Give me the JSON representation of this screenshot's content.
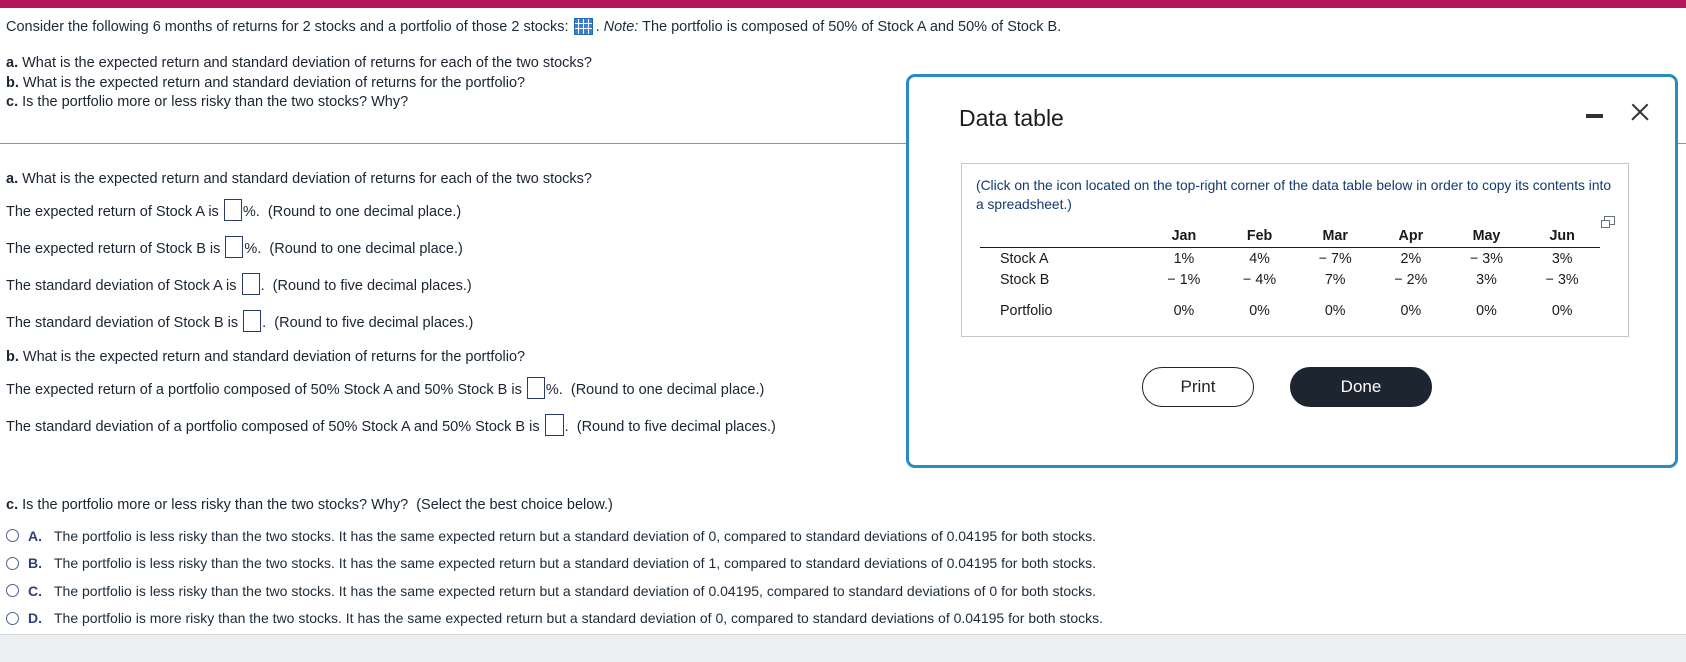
{
  "theme": {
    "accent_bar_color": "#b4175c",
    "dialog_border_color": "#2b8cbe",
    "link_text_color": "#123a6e",
    "done_button_color": "#1d2530"
  },
  "worksheet": {
    "intro_prefix": "Consider the following 6 months of returns for 2 stocks and a portfolio of those 2 stocks:",
    "intro_icon": "spreadsheet-grid-icon",
    "intro_separator": ".",
    "note_label": "Note:",
    "intro_suffix": "The portfolio is composed of 50% of Stock A and 50% of Stock B.",
    "questions": [
      {
        "letter": "a.",
        "text": "What is the expected return and standard deviation of returns for each of the two stocks?"
      },
      {
        "letter": "b.",
        "text": "What is the expected return and standard deviation of returns for the portfolio?"
      },
      {
        "letter": "c.",
        "text": "Is the portfolio more or less risky than the two stocks? Why?"
      }
    ]
  },
  "answers": {
    "part_a_heading_letter": "a.",
    "part_a_heading": "What is the expected return and standard deviation of returns for each of the two stocks?",
    "rows_a": [
      {
        "pre": "The expected return of Stock A is",
        "blank_value": "",
        "post_unit": "%.",
        "hint": "(Round to one decimal place.)"
      },
      {
        "pre": "The expected return of Stock B is",
        "blank_value": "",
        "post_unit": "%.",
        "hint": "(Round to one decimal place.)"
      },
      {
        "pre": "The standard deviation of Stock A is",
        "blank_value": "",
        "post_unit": ".",
        "hint": "(Round to five decimal places.)"
      },
      {
        "pre": "The standard deviation of Stock B is",
        "blank_value": "",
        "post_unit": ".",
        "hint": "(Round to five decimal places.)"
      }
    ],
    "part_b_heading_letter": "b.",
    "part_b_heading": "What is the expected return and standard deviation of returns for the portfolio?",
    "rows_b": [
      {
        "pre": "The expected return of a portfolio composed of 50% Stock A and 50% Stock B is",
        "blank_value": "",
        "post_unit": "%.",
        "hint": "(Round to one decimal place.)"
      },
      {
        "pre": "The standard deviation of a portfolio composed of 50% Stock A and 50% Stock B is",
        "blank_value": "",
        "post_unit": ".",
        "hint": "(Round to five decimal places.)"
      }
    ]
  },
  "choices": {
    "prompt_letter": "c.",
    "prompt": "Is the portfolio more or less risky than the two stocks? Why?",
    "prompt_hint": "(Select the best choice below.)",
    "selected": null,
    "options": [
      {
        "letter": "A.",
        "text": "The portfolio is less risky than the two stocks. It has the same expected return but a standard deviation of 0, compared to standard deviations of 0.04195 for both stocks."
      },
      {
        "letter": "B.",
        "text": "The portfolio is less risky than the two stocks. It has the same expected return but a standard deviation of 1, compared to standard deviations of 0.04195 for both stocks."
      },
      {
        "letter": "C.",
        "text": "The portfolio is less risky than the two stocks. It has the same expected return but a standard deviation of 0.04195, compared to standard deviations of 0 for both stocks."
      },
      {
        "letter": "D.",
        "text": "The portfolio is more risky than the two stocks. It has the same expected return but a standard deviation of 0, compared to standard deviations of 0.04195 for both stocks."
      }
    ]
  },
  "dialog": {
    "title": "Data table",
    "minimize_icon": "minimize-icon",
    "close_icon": "close-icon",
    "copy_hint": "(Click on the icon located on the top-right corner of the data table below in order to copy its contents into a spreadsheet.)",
    "copy_icon": "copy-to-spreadsheet-icon",
    "table": {
      "row_label_header": "",
      "columns": [
        "Jan",
        "Feb",
        "Mar",
        "Apr",
        "May",
        "Jun"
      ],
      "rows": [
        {
          "label": "Stock A",
          "values": [
            "1%",
            "4%",
            "− 7%",
            "2%",
            "− 3%",
            "3%"
          ]
        },
        {
          "label": "Stock B",
          "values": [
            "− 1%",
            "− 4%",
            "7%",
            "− 2%",
            "3%",
            "− 3%"
          ]
        }
      ],
      "summary_row": {
        "label": "Portfolio",
        "values": [
          "0%",
          "0%",
          "0%",
          "0%",
          "0%",
          "0%"
        ]
      }
    },
    "print_label": "Print",
    "done_label": "Done"
  }
}
